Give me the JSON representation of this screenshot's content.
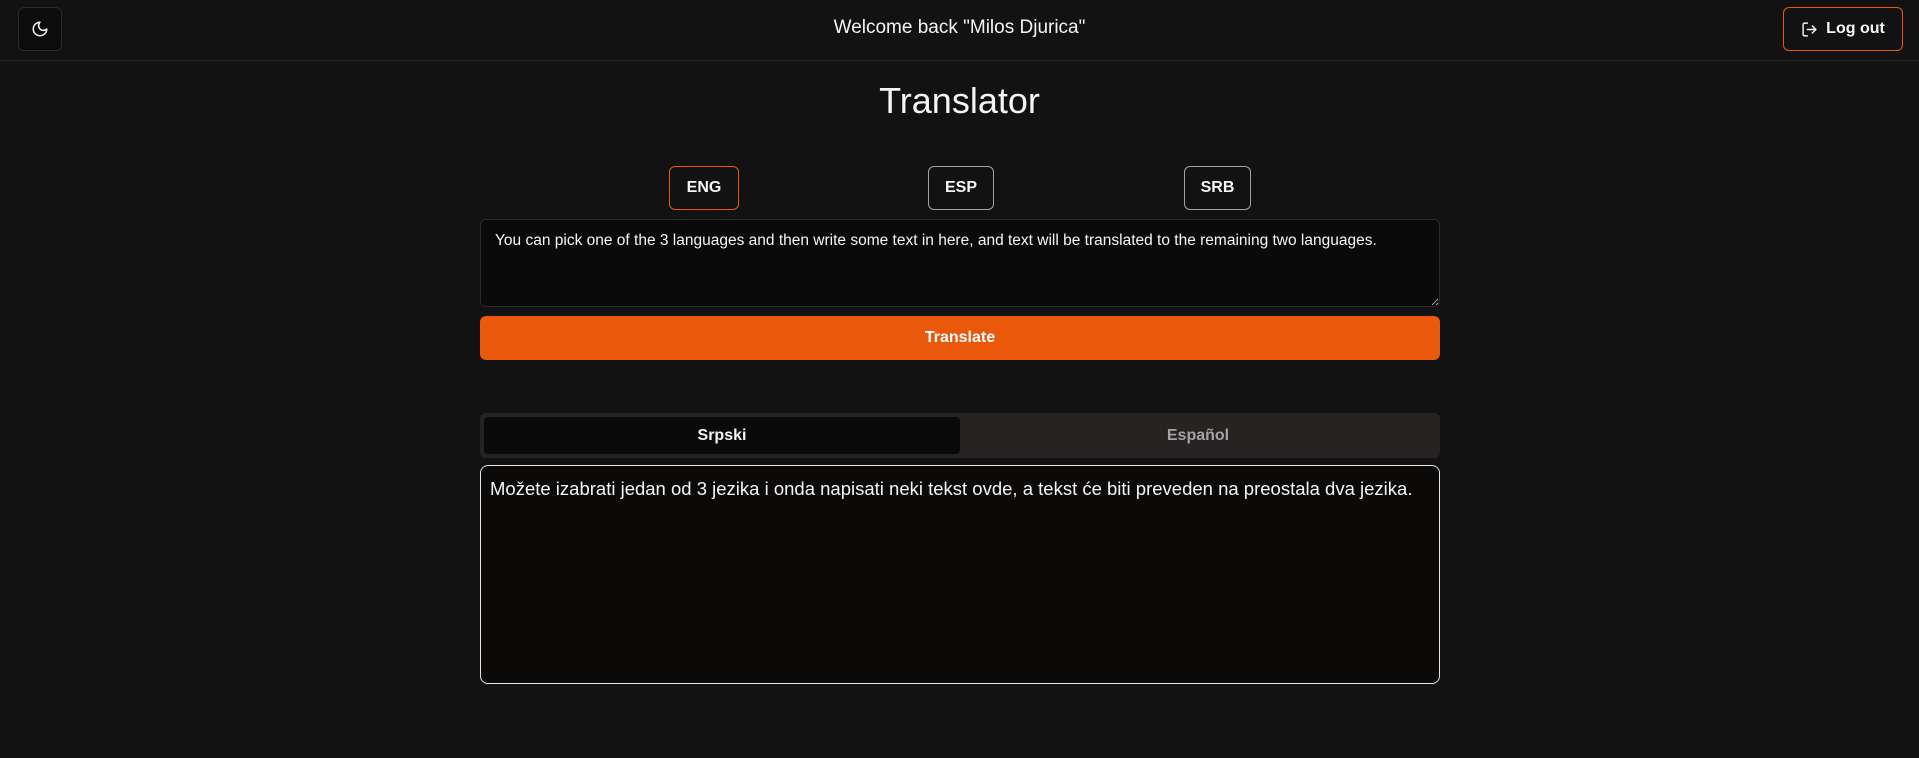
{
  "header": {
    "theme_icon": "moon-icon",
    "welcome_text": "Welcome back \"Milos Djurica\"",
    "logout_label": "Log out",
    "logout_icon": "log-out-icon"
  },
  "page_title": "Translator",
  "languages": [
    {
      "label": "ENG",
      "selected": true
    },
    {
      "label": "ESP",
      "selected": false
    },
    {
      "label": "SRB",
      "selected": false
    }
  ],
  "input": {
    "value": "You can pick one of the 3 languages and then write some text in here, and text will be translated to the remaining two languages."
  },
  "translate_label": "Translate",
  "result_tabs": [
    {
      "label": "Srpski",
      "active": true
    },
    {
      "label": "Español",
      "active": false
    }
  ],
  "output_text": "Možete izabrati jedan od 3 jezika i onda napisati neki tekst ovde, a tekst će biti preveden na preostala dva jezika.",
  "colors": {
    "accent": "#ea580c",
    "background": "#121212",
    "text": "#f5f5f5"
  }
}
